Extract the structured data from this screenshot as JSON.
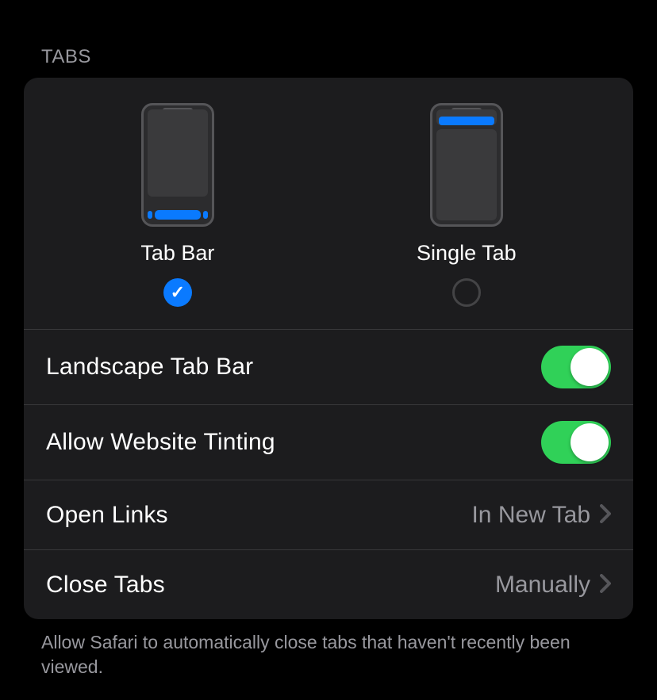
{
  "section": {
    "header": "TABS",
    "footer": "Allow Safari to automatically close tabs that haven't recently been viewed."
  },
  "layout_options": {
    "tab_bar": {
      "label": "Tab Bar",
      "selected": true
    },
    "single_tab": {
      "label": "Single Tab",
      "selected": false
    }
  },
  "rows": {
    "landscape_tab_bar": {
      "label": "Landscape Tab Bar",
      "enabled": true
    },
    "allow_website_tinting": {
      "label": "Allow Website Tinting",
      "enabled": true
    },
    "open_links": {
      "label": "Open Links",
      "value": "In New Tab"
    },
    "close_tabs": {
      "label": "Close Tabs",
      "value": "Manually"
    }
  }
}
